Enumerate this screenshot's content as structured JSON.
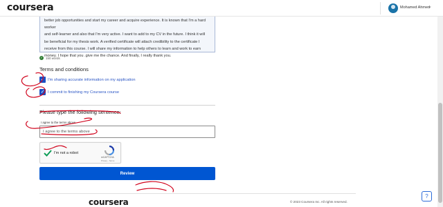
{
  "header": {
    "logo": "coursera",
    "user_name": "Mohamed Ahmed",
    "chevron": "⌄"
  },
  "essay": {
    "lines": [
      "better job opportunities and start my career and acquire experience. It is known that I'm a hard worker",
      "and self-learner and also that I'm very active. I want to add to my CV in the future. I think it will",
      "be beneficial for my thesis work. A verified certificate will attach credibility to the certificate I",
      "receive from this course. I will share my information to help others to learn and work to earn",
      "money. I hope that you .give me the chance. And finally, I really thank you."
    ],
    "word_count": "150 words"
  },
  "terms": {
    "title": "Terms and conditions",
    "items": [
      {
        "label": "I'm sharing accurate information on my application",
        "checked": true
      },
      {
        "label": "I commit to finishing my Coursera course",
        "checked": true
      }
    ]
  },
  "sentence": {
    "title": "Please type the following sentence:",
    "prompt": "I agree to the terms above",
    "input_value": "I agree to the terms above"
  },
  "captcha": {
    "label": "I'm not a robot",
    "brand": "reCAPTCHA",
    "links": "Privacy - Terms"
  },
  "review_button": "Review",
  "footer": {
    "logo": "coursera",
    "copyright": "© 2023 Coursera Inc. All rights reserved."
  },
  "help_icon": "help-icon",
  "colors": {
    "primary": "#0056d2",
    "checkbox": "#1a4fc4",
    "link": "#2b56c5",
    "annotation": "#d0021b"
  }
}
